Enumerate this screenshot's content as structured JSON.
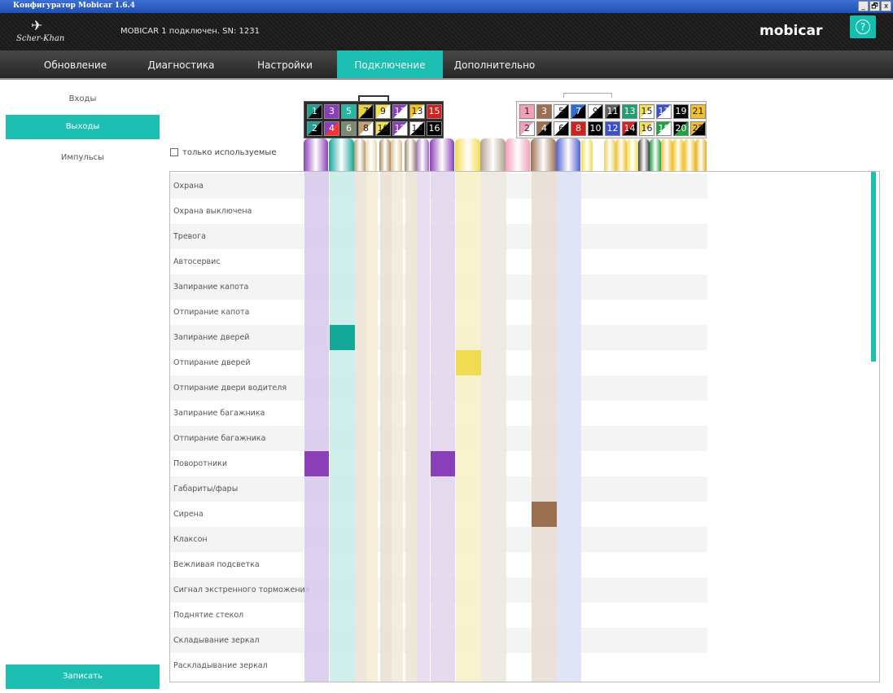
{
  "window": {
    "title": "Конфигуратор Mobicar 1.6.4",
    "buttons": [
      "_",
      "🗗",
      "x"
    ]
  },
  "header": {
    "logo_text": "Scher-Khan",
    "status": "MOBICAR 1 подключен. SN: 1231",
    "brand": "mobicar",
    "help_icon": "?"
  },
  "tabs": [
    {
      "label": "Обновление",
      "active": false
    },
    {
      "label": "Диагностика",
      "active": false
    },
    {
      "label": "Настройки",
      "active": false
    },
    {
      "label": "Подключение",
      "active": true
    },
    {
      "label": "Дополнительно",
      "active": false
    }
  ],
  "sidebar": {
    "items": [
      {
        "label": "Входы",
        "active": false
      },
      {
        "label": "Выходы",
        "active": true
      },
      {
        "label": "Импульсы",
        "active": false
      }
    ],
    "save_label": "Записать"
  },
  "filter": {
    "label": "только используемые",
    "checked": false
  },
  "connector_left": {
    "top": [
      {
        "num": "1",
        "color": "#20a090",
        "color2": "#000000"
      },
      {
        "num": "3",
        "color": "#8a3fb8"
      },
      {
        "num": "5",
        "color": "#22b8a4"
      },
      {
        "num": "7",
        "color": "#e8d23a",
        "color2": "#000000"
      },
      {
        "num": "9",
        "color": "#f2e05a",
        "color2": "#ffffff"
      },
      {
        "num": "11",
        "color": "#8a3fb8",
        "color2": "#ffffff"
      },
      {
        "num": "13",
        "color": "#f2c318",
        "color2": "#ffffff"
      },
      {
        "num": "15",
        "color": "#d42020"
      }
    ],
    "bottom": [
      {
        "num": "2",
        "color": "#20a090",
        "color2": "#000000"
      },
      {
        "num": "4",
        "color": "#8a3fb8",
        "color2": "#ff3030"
      },
      {
        "num": "6",
        "color": "#7a8a70"
      },
      {
        "num": "8",
        "color": "#c8a070",
        "color2": "#ffffff"
      },
      {
        "num": "10",
        "color": "#f2e05a",
        "color2": "#000000"
      },
      {
        "num": "12",
        "color": "#8a3fb8",
        "color2": "#ffffff"
      },
      {
        "num": "14",
        "color": "#ffffff",
        "color2": "#000000"
      },
      {
        "num": "16",
        "color": "#000000"
      }
    ]
  },
  "connector_right": {
    "top": [
      {
        "num": "1",
        "color": "#f2a0b8"
      },
      {
        "num": "3",
        "color": "#9a7050"
      },
      {
        "num": "5",
        "color": "#ffffff",
        "color2": "#000000"
      },
      {
        "num": "7",
        "color": "#2a70d0",
        "color2": "#000000"
      },
      {
        "num": "9",
        "color": "#ffffff",
        "color2": "#000000"
      },
      {
        "num": "11",
        "color": "#606060",
        "color2": "#000000"
      },
      {
        "num": "13",
        "color": "#20a070"
      },
      {
        "num": "15",
        "color": "#f2e05a",
        "color2": "#ffffff"
      },
      {
        "num": "17",
        "color": "#3a50d0",
        "color2": "#ffffff"
      },
      {
        "num": "19",
        "color": "#000000"
      },
      {
        "num": "21",
        "color": "#f0c030"
      }
    ],
    "bottom": [
      {
        "num": "2",
        "color": "#f2a0b8",
        "color2": "#ffffff"
      },
      {
        "num": "4",
        "color": "#9a7050",
        "color2": "#000000"
      },
      {
        "num": "6",
        "color": "#ffffff",
        "color2": "#000000"
      },
      {
        "num": "8",
        "color": "#d42020"
      },
      {
        "num": "10",
        "color": "#000000"
      },
      {
        "num": "12",
        "color": "#3a50d0"
      },
      {
        "num": "14",
        "color": "#d42020",
        "color2": "#000000"
      },
      {
        "num": "16",
        "color": "#f2e05a",
        "color2": "#ffffff"
      },
      {
        "num": "18",
        "color": "#20a040",
        "color2": "#ffffff"
      },
      {
        "num": "20",
        "color": "#000000",
        "color2": "#20a040"
      },
      {
        "num": "22",
        "color": "#f0c030",
        "color2": "#000000"
      }
    ]
  },
  "outputs": [
    "Охрана",
    "Охрана выключена",
    "Тревога",
    "Автосервис",
    "Запирание капота",
    "Отпирание капота",
    "Запирание дверей",
    "Отпирание дверей",
    "Отпирание двери водителя",
    "Запирание багажника",
    "Отпирание багажника",
    "Поворотники",
    "Габариты/фары",
    "Сирена",
    "Клаксон",
    "Вежливая подсветка",
    "Сигнал экстренного торможения",
    "Поднятие стекол",
    "Складывание зеркал",
    "Раскладывание зеркал"
  ],
  "assignments": [
    {
      "output": "Поворотники",
      "wire_color": "#8a3fb8"
    },
    {
      "output": "Запирание дверей",
      "wire_color": "#14a898"
    },
    {
      "output": "Отпирание дверей",
      "wire_color": "#f0dc50"
    },
    {
      "output": "Поворотники",
      "wire_color": "#8a3fb8"
    },
    {
      "output": "Сирена",
      "wire_color": "#9a7050"
    }
  ]
}
